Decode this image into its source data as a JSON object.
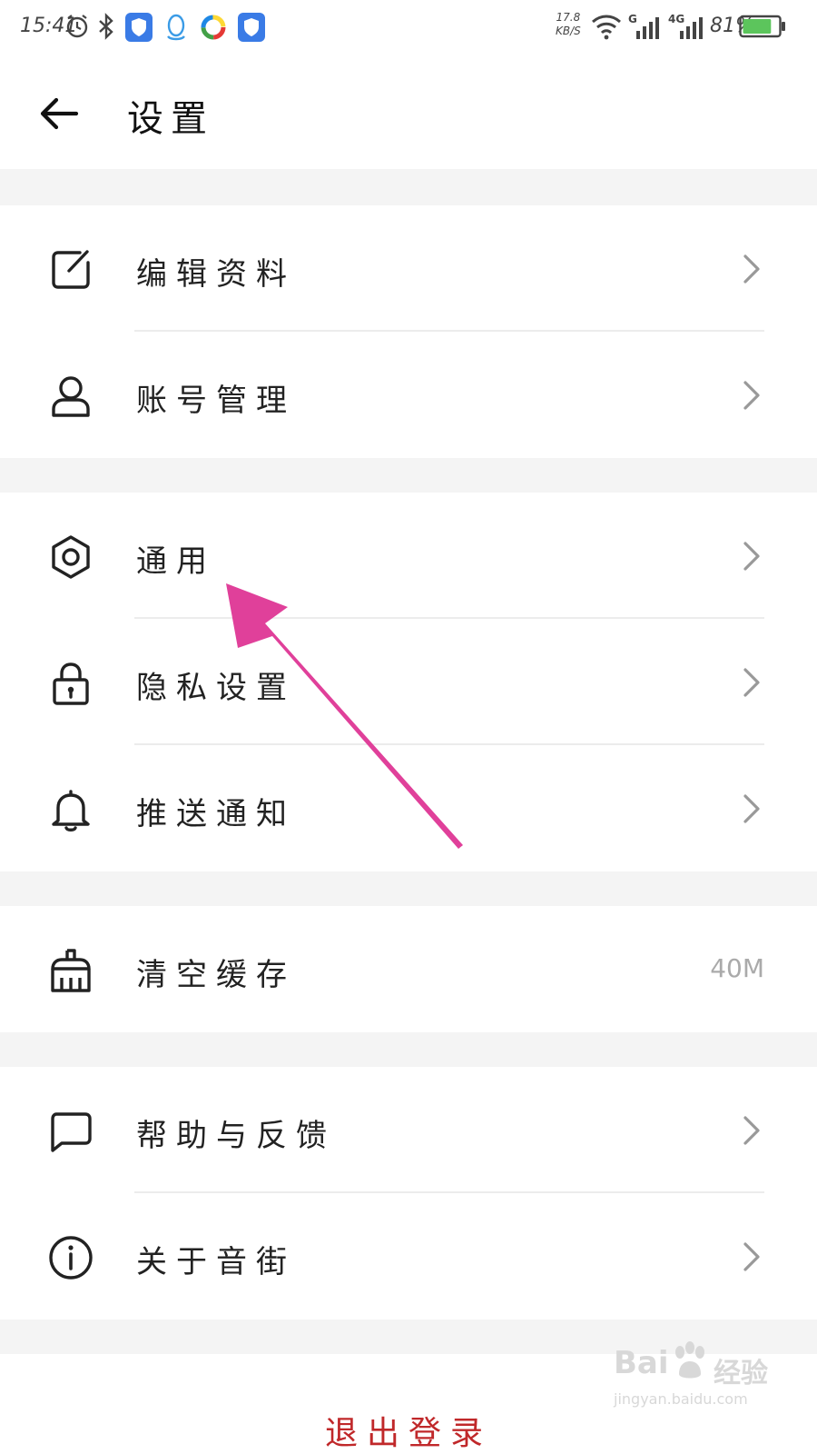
{
  "status_bar": {
    "time": "15:41",
    "net_speed_value": "17.8",
    "net_speed_unit": "KB/S",
    "signal_1_label": "G",
    "signal_2_label": "4G",
    "battery_percent": "81%",
    "battery_level": 0.81,
    "battery_color": "#5cc55c"
  },
  "header": {
    "title": "设置"
  },
  "groups": [
    {
      "items": [
        {
          "label": "编辑资料",
          "icon": "edit-icon"
        },
        {
          "label": "账号管理",
          "icon": "user-icon"
        }
      ]
    },
    {
      "items": [
        {
          "label": "通用",
          "icon": "hexagon-settings-icon"
        },
        {
          "label": "隐私设置",
          "icon": "lock-icon"
        },
        {
          "label": "推送通知",
          "icon": "bell-icon"
        }
      ]
    },
    {
      "items": [
        {
          "label": "清空缓存",
          "icon": "broom-icon",
          "value": "40M"
        }
      ]
    },
    {
      "items": [
        {
          "label": "帮助与反馈",
          "icon": "chat-bubble-icon"
        },
        {
          "label": "关于音街",
          "icon": "info-icon"
        }
      ]
    }
  ],
  "logout": {
    "label": "退出登录",
    "color": "#c0282a"
  },
  "annotation": {
    "arrow_color": "#e0409a"
  },
  "watermark": {
    "logo": "Bai",
    "brand": "经验",
    "url": "jingyan.baidu.com"
  }
}
